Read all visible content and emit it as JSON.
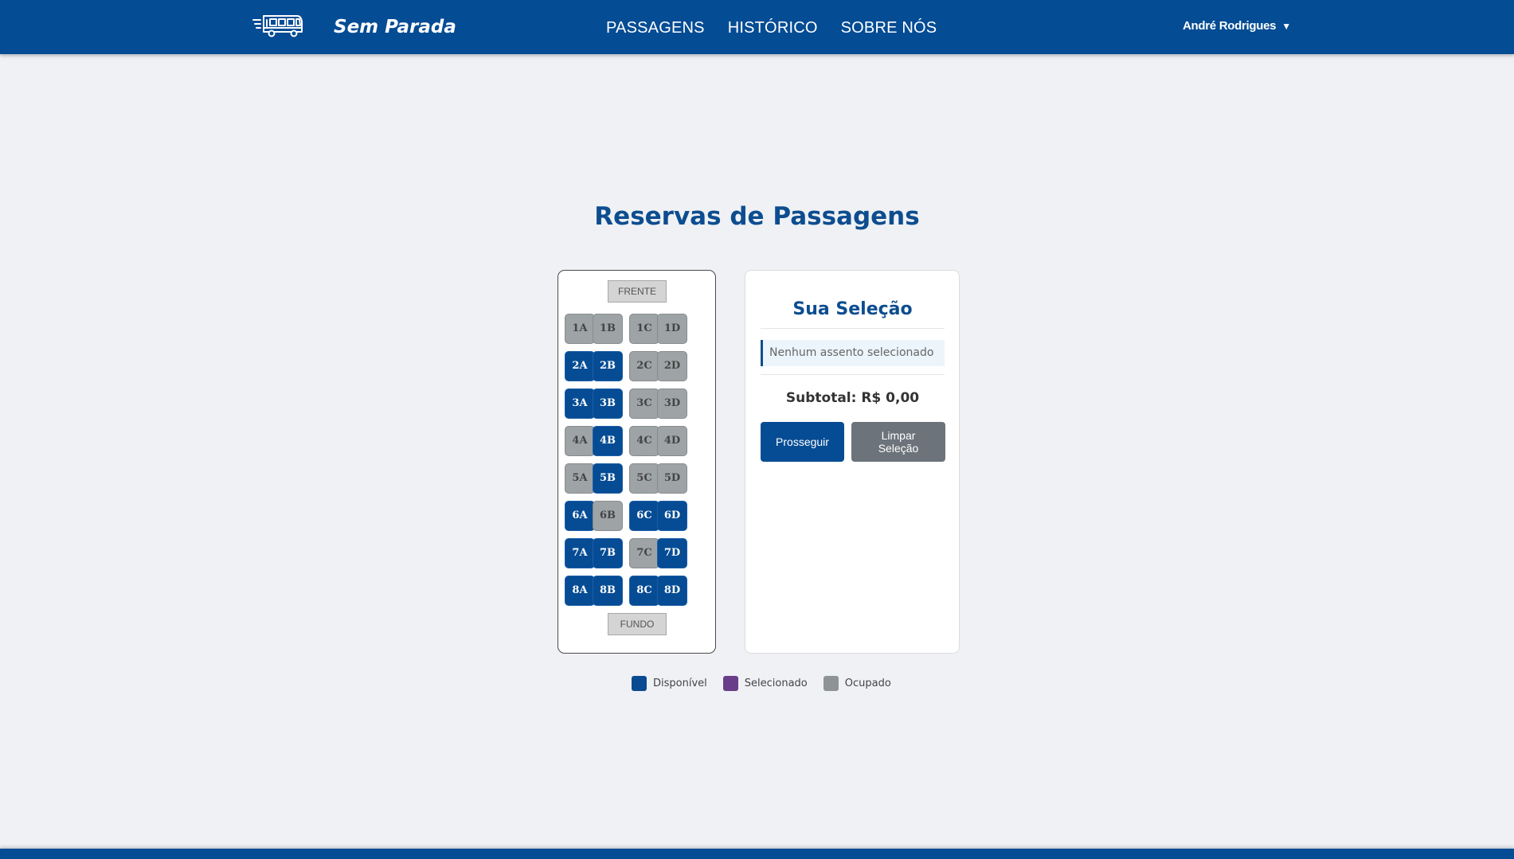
{
  "header": {
    "brand": "Sem Parada",
    "logo_icon": "bus-icon",
    "nav": [
      "PASSAGENS",
      "HISTÓRICO",
      "SOBRE NÓS"
    ],
    "user": "André Rodrigues",
    "user_caret": "▼"
  },
  "page": {
    "title": "Reservas de Passagens"
  },
  "bus": {
    "front_label": "FRENTE",
    "back_label": "FUNDO",
    "rows": [
      [
        {
          "id": "1A",
          "status": "occupied"
        },
        {
          "id": "1B",
          "status": "occupied"
        },
        {
          "id": "1C",
          "status": "occupied"
        },
        {
          "id": "1D",
          "status": "occupied"
        }
      ],
      [
        {
          "id": "2A",
          "status": "available"
        },
        {
          "id": "2B",
          "status": "available"
        },
        {
          "id": "2C",
          "status": "occupied"
        },
        {
          "id": "2D",
          "status": "occupied"
        }
      ],
      [
        {
          "id": "3A",
          "status": "available"
        },
        {
          "id": "3B",
          "status": "available"
        },
        {
          "id": "3C",
          "status": "occupied"
        },
        {
          "id": "3D",
          "status": "occupied"
        }
      ],
      [
        {
          "id": "4A",
          "status": "occupied"
        },
        {
          "id": "4B",
          "status": "available"
        },
        {
          "id": "4C",
          "status": "occupied"
        },
        {
          "id": "4D",
          "status": "occupied"
        }
      ],
      [
        {
          "id": "5A",
          "status": "occupied"
        },
        {
          "id": "5B",
          "status": "available"
        },
        {
          "id": "5C",
          "status": "occupied"
        },
        {
          "id": "5D",
          "status": "occupied"
        }
      ],
      [
        {
          "id": "6A",
          "status": "available"
        },
        {
          "id": "6B",
          "status": "occupied"
        },
        {
          "id": "6C",
          "status": "available"
        },
        {
          "id": "6D",
          "status": "available"
        }
      ],
      [
        {
          "id": "7A",
          "status": "available"
        },
        {
          "id": "7B",
          "status": "available"
        },
        {
          "id": "7C",
          "status": "occupied"
        },
        {
          "id": "7D",
          "status": "available"
        }
      ],
      [
        {
          "id": "8A",
          "status": "available"
        },
        {
          "id": "8B",
          "status": "available"
        },
        {
          "id": "8C",
          "status": "available"
        },
        {
          "id": "8D",
          "status": "available"
        }
      ]
    ]
  },
  "selection": {
    "title": "Sua Seleção",
    "empty_text": "Nenhum assento selecionado",
    "subtotal": "Subtotal: R$ 0,00",
    "proceed_label": "Prosseguir",
    "clear_label": "Limpar Seleção"
  },
  "legend": [
    {
      "label": "Disponível",
      "color": "#0a4a91"
    },
    {
      "label": "Selecionado",
      "color": "#6a3d8a"
    },
    {
      "label": "Ocupado",
      "color": "#8e9496"
    }
  ],
  "colors": {
    "primary": "#044c94",
    "background": "#eff1f5",
    "occupied": "#9ea3a5"
  }
}
